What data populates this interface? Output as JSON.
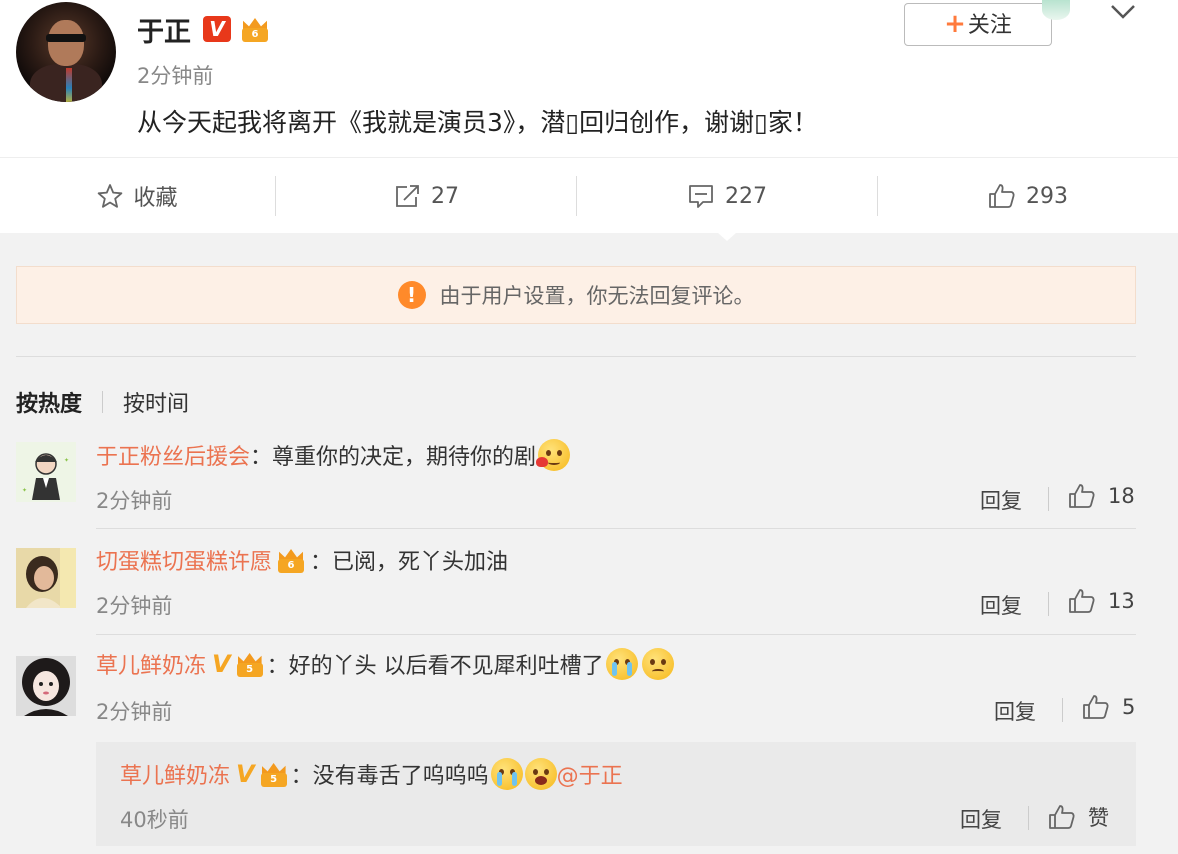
{
  "post": {
    "author": "于正",
    "vip_badge": "V",
    "time": "2分钟前",
    "text": "从今天起我将离开《我就是演员3》，潜▯回归创作，谢谢▯家！",
    "follow_label": "关注",
    "follow_plus": "+"
  },
  "actions": {
    "favorite_label": "收藏",
    "repost_count": "27",
    "comment_count": "227",
    "like_count": "293"
  },
  "notice": {
    "text": "由于用户设置，你无法回复评论。",
    "icon": "!"
  },
  "sort": {
    "hot": "按热度",
    "time": "按时间"
  },
  "comments": [
    {
      "name": "于正粉丝后援会",
      "text": "：尊重你的决定，期待你的剧",
      "time": "2分钟前",
      "reply": "回复",
      "likes": "18"
    },
    {
      "name": "切蛋糕切蛋糕许愿",
      "text": "：已阅，死丫头加油",
      "time": "2分钟前",
      "reply": "回复",
      "likes": "13"
    },
    {
      "name": "草儿鲜奶冻",
      "text": "：好的丫头 以后看不见犀利吐槽了",
      "time": "2分钟前",
      "reply": "回复",
      "likes": "5"
    }
  ],
  "subreply": {
    "name": "草儿鲜奶冻",
    "text": "：没有毒舌了呜呜呜",
    "mention": "@于正",
    "time": "40秒前",
    "reply": "回复",
    "like_label": "赞"
  },
  "colors": {
    "username": "#eb7350",
    "verified": "#e8381a",
    "crown": "#f5a623",
    "notice_bg": "#fdf0e6",
    "warn": "#ff8a2a"
  }
}
